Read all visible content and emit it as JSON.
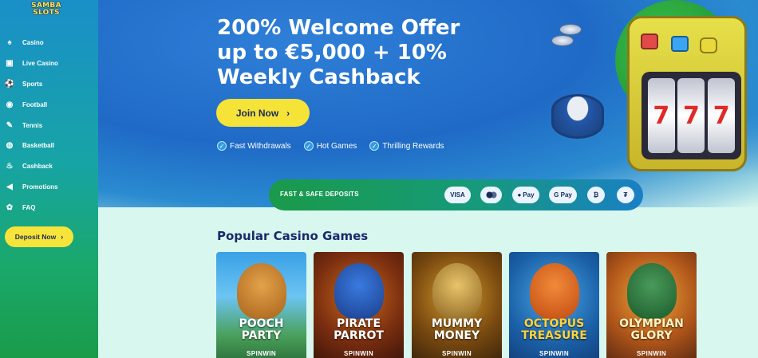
{
  "brand": {
    "logo_line1": "SAMBA",
    "logo_line2": "SLOTS"
  },
  "sidebar": {
    "items": [
      {
        "label": "Casino",
        "icon": "casino-icon",
        "glyph": "♠"
      },
      {
        "label": "Live Casino",
        "icon": "live-casino-icon",
        "glyph": "▣"
      },
      {
        "label": "Sports",
        "icon": "sports-icon",
        "glyph": "⚽"
      },
      {
        "label": "Football",
        "icon": "football-icon",
        "glyph": "◉"
      },
      {
        "label": "Tennis",
        "icon": "tennis-icon",
        "glyph": "✎"
      },
      {
        "label": "Basketball",
        "icon": "basketball-icon",
        "glyph": "◍"
      },
      {
        "label": "Cashback",
        "icon": "cashback-icon",
        "glyph": "♨"
      },
      {
        "label": "Promotions",
        "icon": "megaphone-icon",
        "glyph": "◀"
      },
      {
        "label": "FAQ",
        "icon": "faq-icon",
        "glyph": "✿"
      }
    ],
    "deposit_label": "Deposit Now"
  },
  "hero": {
    "title": "200% Welcome Offer up to €5,000 + 10% Weekly Cashback",
    "join_label": "Join Now",
    "features": [
      "Fast Withdrawals",
      "Hot Games",
      "Thrilling Rewards"
    ]
  },
  "deposits": {
    "title": "FAST & SAFE DEPOSITS",
    "methods": [
      "VISA",
      "",
      "Pay",
      "G Pay",
      "₿",
      "₮"
    ]
  },
  "games": {
    "title": "Popular Casino Games",
    "items": [
      {
        "name_line1": "POOCH",
        "name_line2": "PARTY",
        "provider": "SPINWIN"
      },
      {
        "name_line1": "PIRATE",
        "name_line2": "PARROT",
        "provider": "SPINWIN"
      },
      {
        "name_line1": "MUMMY",
        "name_line2": "MONEY",
        "provider": "SPINWIN"
      },
      {
        "name_line1": "OCTOPUS",
        "name_line2": "TREASURE",
        "provider": "SPINWIN"
      },
      {
        "name_line1": "OLYMPIAN",
        "name_line2": "GLORY",
        "provider": "SPINWIN"
      }
    ]
  },
  "colors": {
    "accent_yellow": "#f5e338",
    "title_navy": "#1a2a6a",
    "sidebar_green": "#1a9b4a"
  }
}
